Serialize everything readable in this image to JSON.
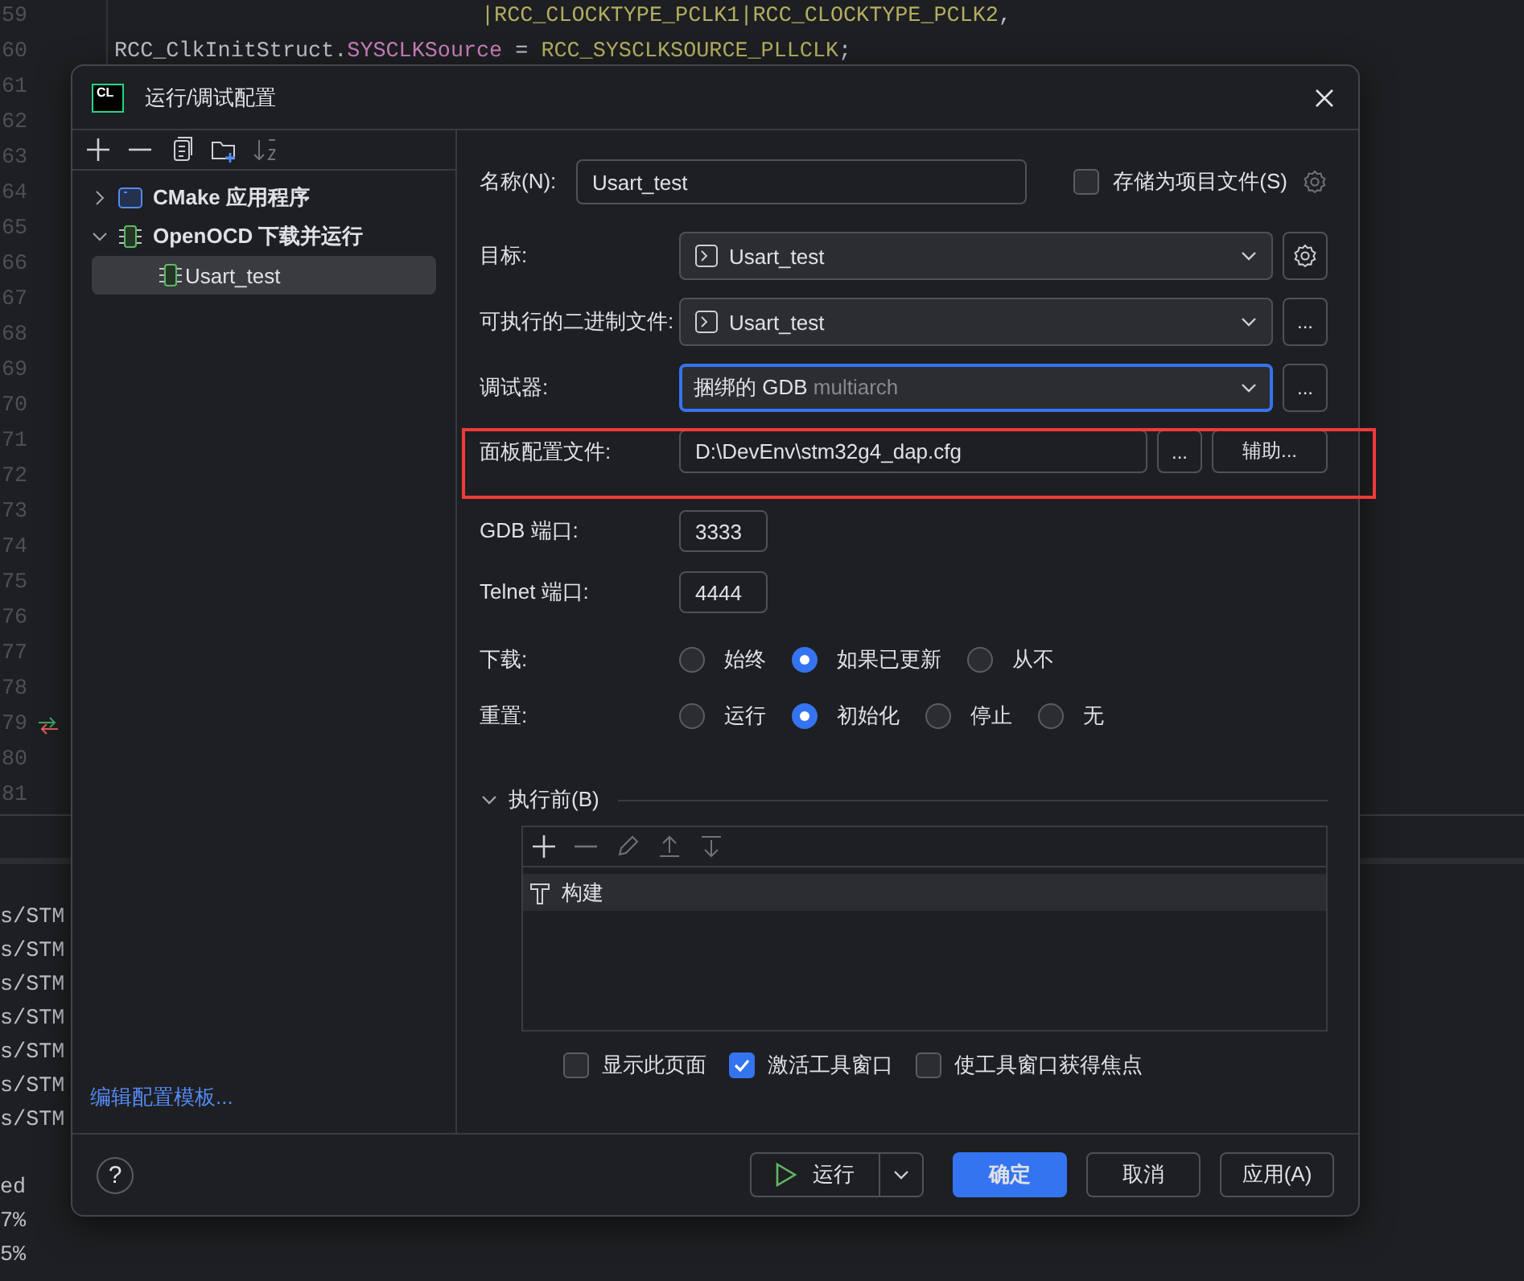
{
  "editor": {
    "line_numbers": [
      {
        "number": "59"
      },
      {
        "number": "60"
      },
      {
        "number": "61"
      },
      {
        "number": "62"
      },
      {
        "number": "63"
      },
      {
        "number": "64"
      },
      {
        "number": "65"
      },
      {
        "number": "66"
      },
      {
        "number": "67"
      },
      {
        "number": "68"
      },
      {
        "number": "69"
      },
      {
        "number": "70"
      },
      {
        "number": "71"
      },
      {
        "number": "72"
      },
      {
        "number": "73"
      },
      {
        "number": "74"
      },
      {
        "number": "75"
      },
      {
        "number": "76"
      },
      {
        "number": "77"
      },
      {
        "number": "78"
      },
      {
        "number": "79",
        "step_marker": true
      },
      {
        "number": "80"
      },
      {
        "number": "81"
      }
    ],
    "code_lines": [
      {
        "kind": "continuation",
        "tokens": [
          {
            "kind": "const",
            "text": "|RCC_CLOCKTYPE_PCLK1|RCC_CLOCKTYPE_PCLK2"
          },
          {
            "kind": "plain",
            "text": ","
          }
        ]
      },
      {
        "kind": "statement",
        "tokens": [
          {
            "kind": "plain",
            "text": "RCC_ClkInitStruct."
          },
          {
            "kind": "field",
            "text": "SYSCLKSource"
          },
          {
            "kind": "plain",
            "text": " = "
          },
          {
            "kind": "const",
            "text": "RCC_SYSCLKSOURCE_PLLCLK"
          },
          {
            "kind": "plain",
            "text": ";"
          }
        ]
      }
    ]
  },
  "terminal": {
    "lines": [
      {
        "kind": "path",
        "text": "s/STM"
      },
      {
        "kind": "path",
        "text": "s/STM"
      },
      {
        "kind": "path",
        "text": "s/STM"
      },
      {
        "kind": "path",
        "text": "s/STM"
      },
      {
        "kind": "path",
        "text": "s/STM"
      },
      {
        "kind": "path",
        "text": "s/STM"
      },
      {
        "kind": "path",
        "text": "s/STM"
      },
      {
        "kind": "status",
        "text": "ed"
      },
      {
        "kind": "status",
        "text": "7%"
      },
      {
        "kind": "status",
        "text": "5%"
      }
    ]
  },
  "dialog": {
    "logo": "CL",
    "title": "运行/调试配置",
    "sidebar": {
      "toolbar": [
        {
          "kind": "add",
          "disabled": false
        },
        {
          "kind": "remove",
          "disabled": false
        },
        {
          "kind": "copy",
          "disabled": false
        },
        {
          "kind": "folder",
          "disabled": false
        },
        {
          "kind": "sort",
          "disabled": true
        }
      ],
      "tree": [
        {
          "label": "CMake 应用程序",
          "kind": "cmake",
          "expanded": false,
          "selected": false
        },
        {
          "label": "OpenOCD 下载并运行",
          "kind": "openocd",
          "expanded": true,
          "selected": false,
          "children": [
            {
              "label": "Usart_test",
              "kind": "openocd",
              "selected": true
            }
          ]
        }
      ],
      "link": "编辑配置模板..."
    },
    "form": {
      "name": {
        "label": "名称(N):",
        "value": "Usart_test"
      },
      "store": {
        "label": "存储为项目文件(S)",
        "checked": false
      },
      "rows": [
        {
          "kind": "dropdown",
          "label": "目标:",
          "value": "Usart_test",
          "value_icon": true,
          "focused": false,
          "buttons": [
            {
              "kind": "gear"
            }
          ]
        },
        {
          "kind": "dropdown",
          "label": "可执行的二进制文件:",
          "value": "Usart_test",
          "value_icon": true,
          "focused": false,
          "buttons": [
            {
              "kind": "text",
              "text": "..."
            }
          ]
        },
        {
          "kind": "dropdown",
          "label": "调试器:",
          "value": "捆绑的 GDB",
          "hint": "multiarch",
          "value_icon": false,
          "focused": true,
          "buttons": [
            {
              "kind": "text",
              "text": "..."
            }
          ]
        },
        {
          "kind": "file",
          "label": "面板配置文件:",
          "value": "D:\\DevEnv\\stm32g4_dap.cfg",
          "highlighted": true,
          "buttons": [
            {
              "kind": "text",
              "text": "..."
            },
            {
              "kind": "wide",
              "text": "辅助..."
            }
          ]
        },
        {
          "kind": "port",
          "label": "GDB 端口:",
          "value": "3333"
        },
        {
          "kind": "port",
          "label": "Telnet 端口:",
          "value": "4444"
        },
        {
          "kind": "radios",
          "label": "下载:",
          "options": [
            {
              "label": "始终",
              "selected": false
            },
            {
              "label": "如果已更新",
              "selected": true
            },
            {
              "label": "从不",
              "selected": false
            }
          ]
        },
        {
          "kind": "radios",
          "label": "重置:",
          "options": [
            {
              "label": "运行",
              "selected": false
            },
            {
              "label": "初始化",
              "selected": true
            },
            {
              "label": "停止",
              "selected": false
            },
            {
              "label": "无",
              "selected": false
            }
          ]
        }
      ],
      "before_launch": {
        "title": "执行前(B)",
        "expanded": true,
        "toolbar": [
          {
            "kind": "add",
            "disabled": false
          },
          {
            "kind": "remove",
            "disabled": true
          },
          {
            "kind": "edit",
            "disabled": true
          },
          {
            "kind": "up",
            "disabled": true
          },
          {
            "kind": "down",
            "disabled": true
          }
        ],
        "tasks": [
          {
            "label": "构建",
            "selected": true
          }
        ]
      },
      "options": [
        {
          "label": "显示此页面",
          "checked": false
        },
        {
          "label": "激活工具窗口",
          "checked": true
        },
        {
          "label": "使工具窗口获得焦点",
          "checked": false
        }
      ]
    },
    "footer": {
      "help": "?",
      "run": "运行",
      "buttons": [
        {
          "label": "确定",
          "primary": true
        },
        {
          "label": "取消",
          "primary": false
        },
        {
          "label": "应用(A)",
          "primary": false
        }
      ]
    }
  }
}
